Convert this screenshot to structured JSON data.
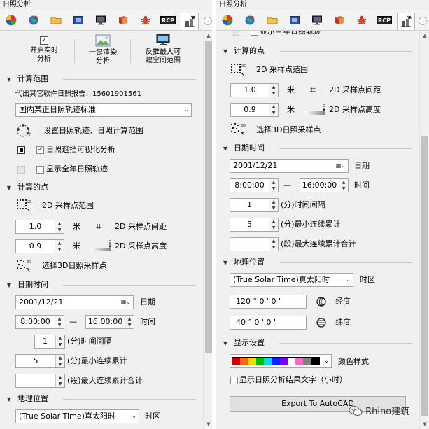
{
  "panel_title": "日照分析",
  "toolbar_more": "⌄",
  "left": {
    "big_buttons": [
      {
        "label_line1": "开启实时",
        "label_line2": "分析"
      },
      {
        "label_line1": "一键渲染",
        "label_line2": "分析"
      },
      {
        "label_line1": "反推最大可",
        "label_line2": "建空间范围"
      }
    ],
    "calc_range": {
      "title": "计算范围",
      "report_text": "代出其它软件日照报告：15601901561",
      "standard_select": "国内某正日照轨迹标准",
      "set_range_label": "设置日照轨迹、日照计算范围",
      "shadow_vis_label": "日照遮挡可视化分析",
      "show_year_label": "显示全年日照轨迹"
    },
    "calc_points": {
      "title": "计算的点",
      "range_2d_label": "2D 采样点范围",
      "spacing_value": "1.0",
      "spacing_unit": "米",
      "spacing_label": "2D 采样点间距",
      "height_value": "0.9",
      "height_unit": "米",
      "height_label": "2D 采样点高度",
      "select_3d_label": "选择3D日照采样点"
    },
    "datetime": {
      "title": "日期时间",
      "date_value": "2001/12/21",
      "date_label": "日期",
      "time_start": "8:00:00",
      "time_sep": "—",
      "time_end": "16:00:00",
      "time_label": "时间",
      "interval_value": "1",
      "interval_label": "(分)时间间隔",
      "min_value": "5",
      "min_label": "(分)最小连续累计",
      "max_value": "",
      "max_label": "(段)最大连续累计合计"
    },
    "geo": {
      "title": "地理位置",
      "tz_value": "(True  Solar  Time)真太阳时",
      "tz_label": "时区"
    }
  },
  "right": {
    "show_year_label": "显示全年日照轨迹",
    "calc_points": {
      "title": "计算的点",
      "range_2d_label": "2D 采样点范围",
      "spacing_value": "1.0",
      "spacing_unit": "米",
      "spacing_label": "2D 采样点间距",
      "height_value": "0.9",
      "height_unit": "米",
      "height_label": "2D 采样点高度",
      "select_3d_label": "选择3D日照采样点"
    },
    "datetime": {
      "title": "日期时间",
      "date_value": "2001/12/21",
      "date_label": "日期",
      "time_start": "8:00:00",
      "time_sep": "—",
      "time_end": "16:00:00",
      "time_label": "时间",
      "interval_value": "1",
      "interval_label": "(分)时间间隔",
      "min_value": "5",
      "min_label": "(分)最小连续累计",
      "max_value": "",
      "max_label": "(段)最大连续累计合计"
    },
    "geo": {
      "title": "地理位置",
      "tz_value": "(True  Solar  Time)真太阳时",
      "tz_label": "时区",
      "lon_value": "120  °  0  '  0  \"",
      "lon_label": "经度",
      "lat_value": "40  °  0  '  0  \"",
      "lat_label": "纬度"
    },
    "display": {
      "title": "显示设置",
      "color_label": "颜色样式",
      "show_text_label": "显示日照分析结果文字（小时）",
      "export_label": "Export To AutoCAD"
    }
  },
  "watermark": "Rhino建筑",
  "colors": {
    "panel_bg": "#f0f0f0",
    "scroll_thumb": "#c2c2c2",
    "color_strip": [
      "#d00000",
      "#ff6a00",
      "#ffd800",
      "#00c000",
      "#00d8ff",
      "#0026ff",
      "#8000ff",
      "#ffffff",
      "#ff66cc",
      "#808080",
      "#000000"
    ]
  },
  "icons": [
    "rhino-sphere-icon",
    "globe-icon",
    "folder-icon",
    "image-icon",
    "monitor-icon",
    "book-icon",
    "bug-icon",
    "rcp-icon",
    "sun-analysis-icon"
  ],
  "icon_labels": {
    "rcp": "RCP"
  }
}
